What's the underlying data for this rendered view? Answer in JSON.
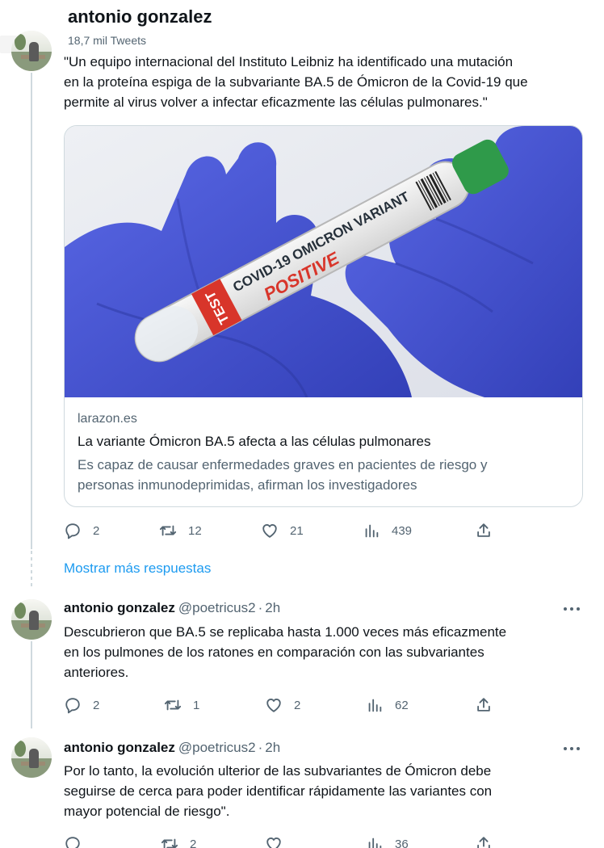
{
  "header": {
    "name": "antonio gonzalez",
    "tweet_count": "18,7 mil Tweets"
  },
  "main_tweet": {
    "text_lines": [
      "\"Un equipo internacional del Instituto Leibniz ha identificado una mutación",
      "en la proteína espiga de la subvariante BA.5 de Ómicron de la Covid-19 que",
      "permite al virus volver a infectar eficazmente las células pulmonares.\""
    ],
    "card": {
      "image_alt": "gloved hands holding a test tube",
      "tube_test_label": "TEST",
      "tube_variant_label": "COVID-19 OMICRON VARIANT",
      "tube_result_label": "POSITIVE",
      "domain": "larazon.es",
      "title": "La variante Ómicron BA.5 afecta a las células pulmonares",
      "description_lines": [
        "Es capaz de causar enfermedades graves en pacientes de riesgo y",
        "personas inmunodeprimidas, afirman los investigadores"
      ]
    },
    "actions": {
      "replies": "2",
      "retweets": "12",
      "likes": "21",
      "views": "439"
    }
  },
  "show_more_label": "Mostrar más respuestas",
  "replies": [
    {
      "name": "antonio gonzalez",
      "handle": "@poetricus2",
      "separator": "·",
      "time": "2h",
      "text_lines": [
        "Descubrieron que BA.5 se replicaba hasta 1.000 veces más eficazmente",
        "en los pulmones de los ratones en comparación con las subvariantes",
        "anteriores."
      ],
      "actions": {
        "replies": "2",
        "retweets": "1",
        "likes": "2",
        "views": "62"
      }
    },
    {
      "name": "antonio gonzalez",
      "handle": "@poetricus2",
      "separator": "·",
      "time": "2h",
      "text_lines": [
        "Por lo tanto, la evolución ulterior de las subvariantes de Ómicron debe",
        "seguirse de cerca para poder identificar rápidamente las variantes con",
        "mayor potencial de riesgo\"."
      ],
      "actions": {
        "replies": "",
        "retweets": "2",
        "likes": "",
        "views": "36"
      }
    }
  ],
  "icons": {
    "reply": "reply-icon",
    "retweet": "retweet-icon",
    "like": "heart-icon",
    "views": "views-icon",
    "share": "share-icon",
    "more": "more-icon"
  },
  "colors": {
    "link_blue": "#1d9bf0",
    "secondary_text": "#536471",
    "glove_blue": "#4a57d8",
    "tube_red": "#d8352a"
  }
}
